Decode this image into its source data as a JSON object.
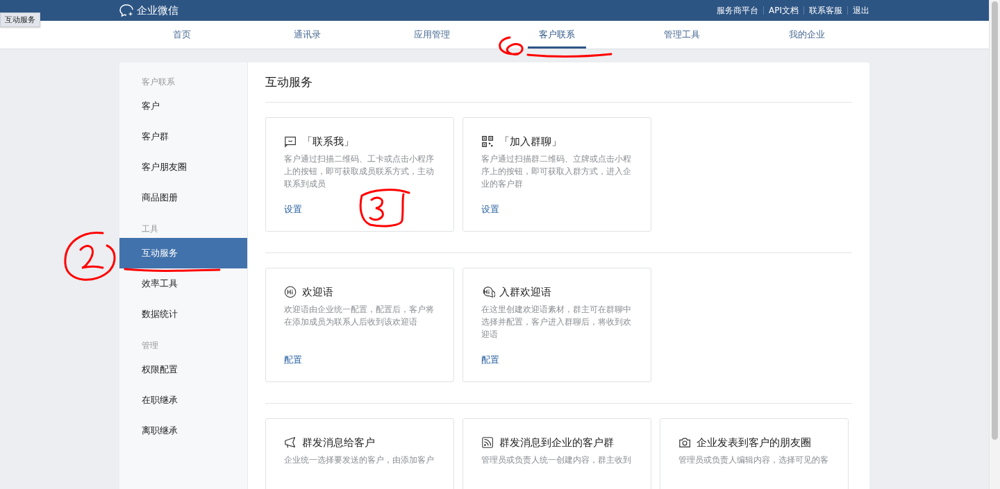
{
  "tooltip": "互动服务",
  "header": {
    "logo": "企业微信",
    "links": [
      "服务商平台",
      "API文档",
      "联系客服",
      "退出"
    ]
  },
  "nav": [
    {
      "label": "首页",
      "selected": false
    },
    {
      "label": "通讯录",
      "selected": false
    },
    {
      "label": "应用管理",
      "selected": false
    },
    {
      "label": "客户联系",
      "selected": true
    },
    {
      "label": "管理工具",
      "selected": false
    },
    {
      "label": "我的企业",
      "selected": false
    }
  ],
  "sidebar": {
    "groups": [
      {
        "title": "客户联系",
        "items": [
          {
            "label": "客户",
            "selected": false
          },
          {
            "label": "客户群",
            "selected": false
          },
          {
            "label": "客户朋友圈",
            "selected": false
          },
          {
            "label": "商品图册",
            "selected": false
          }
        ]
      },
      {
        "title": "工具",
        "items": [
          {
            "label": "互动服务",
            "selected": true
          },
          {
            "label": "效率工具",
            "selected": false
          },
          {
            "label": "数据统计",
            "selected": false
          }
        ]
      },
      {
        "title": "管理",
        "items": [
          {
            "label": "权限配置",
            "selected": false
          },
          {
            "label": "在职继承",
            "selected": false
          },
          {
            "label": "离职继承",
            "selected": false
          }
        ]
      }
    ]
  },
  "main": {
    "title": "互动服务",
    "sections": [
      {
        "cards": [
          {
            "kind": "chat",
            "title": "「联系我」",
            "description": "客户通过扫描二维码、工卡或点击小程序上的按钮，即可获取成员联系方式，主动联系到成员",
            "action": "设置"
          },
          {
            "kind": "qr",
            "title": "「加入群聊」",
            "description": "客户通过扫描群二维码、立牌或点击小程序上的按钮，即可获取入群方式，进入企业的客户群",
            "action": "设置"
          }
        ]
      },
      {
        "cards": [
          {
            "kind": "hi",
            "title": "欢迎语",
            "description": "欢迎语由企业统一配置，配置后，客户将在添加成员为联系人后收到该欢迎语",
            "action": "配置"
          },
          {
            "kind": "hi-group",
            "title": "入群欢迎语",
            "description": "在这里创建欢迎语素材，群主可在群聊中选择并配置，客户进入群聊后，将收到欢迎语",
            "action": "配置"
          }
        ]
      },
      {
        "cards": [
          {
            "kind": "megaphone",
            "title": "群发消息给客户",
            "description": "企业统一选择要发送的客户，由添加客户"
          },
          {
            "kind": "rss",
            "title": "群发消息到企业的客户群",
            "description": "管理员或负责人统一创建内容，群主收到"
          },
          {
            "kind": "camera",
            "title": "企业发表到客户的朋友圈",
            "description": "管理员或负责人编辑内容，选择可见的客"
          }
        ]
      }
    ]
  }
}
